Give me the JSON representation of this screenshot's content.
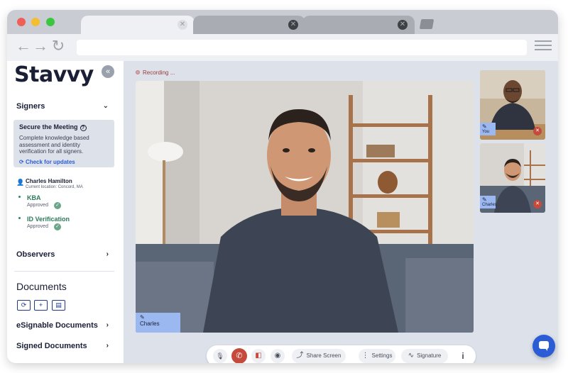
{
  "app": {
    "logo_text": "Stavvy",
    "collapse_glyph": "«"
  },
  "browser": {
    "tabs": [
      {
        "state": "active",
        "close_glyph": "✕"
      },
      {
        "state": "inactive",
        "close_glyph": "✕"
      },
      {
        "state": "inactive",
        "close_glyph": "✕"
      }
    ],
    "nav": {
      "back": "←",
      "forward": "→",
      "reload": "↻"
    }
  },
  "sidebar": {
    "signers": {
      "title": "Signers",
      "chevron": "⌄",
      "secure": {
        "title": "Secure the Meeting",
        "help": "?",
        "description": "Complete knowledge based assessment and identity verification for all signers.",
        "check_updates": "Check for updates",
        "check_icon": "⟳"
      },
      "person": {
        "name": "Charles Hamilton",
        "location": "Current location: Concord, MA",
        "icon": "👤"
      },
      "checks": [
        {
          "label": "KBA",
          "status": "Approved",
          "ok": "✓"
        },
        {
          "label": "ID Verification",
          "status": "Approved",
          "ok": "✓"
        }
      ]
    },
    "observers": {
      "title": "Observers",
      "chevron": "›"
    },
    "documents": {
      "title": "Documents",
      "buttons": [
        {
          "icon": "sync-icon",
          "glyph": "⟳"
        },
        {
          "icon": "plus-icon",
          "glyph": "+"
        },
        {
          "icon": "document-icon",
          "glyph": "▤"
        }
      ],
      "esignable": {
        "title": "eSignable Documents",
        "chevron": "›"
      },
      "signed": {
        "title": "Signed Documents",
        "chevron": "›"
      }
    }
  },
  "meeting": {
    "recording_text": "Recording ...",
    "main_participant": {
      "name": "Charles",
      "icon": "✎"
    },
    "thumbnails": [
      {
        "name": "You",
        "icon": "✎",
        "mute": "✕"
      },
      {
        "name": "Charles",
        "icon": "✎",
        "mute": "✕"
      }
    ]
  },
  "controls": {
    "mute_glyph": "🎙",
    "hangup_glyph": "✆",
    "video_glyph": "◧",
    "camera_glyph": "◉",
    "share_screen": {
      "label": "Share Screen",
      "glyph": "⤴"
    },
    "settings": {
      "label": "Settings",
      "glyph": "⋮"
    },
    "signature": {
      "label": "Signature",
      "glyph": "∿"
    },
    "info_glyph": "i"
  },
  "colors": {
    "brand_dark": "#1a1f36",
    "accent_blue": "#2b5cd6",
    "approved_green": "#2c7a5a",
    "hangup_red": "#c64a3c",
    "name_tag_blue": "#9bb8f0"
  }
}
